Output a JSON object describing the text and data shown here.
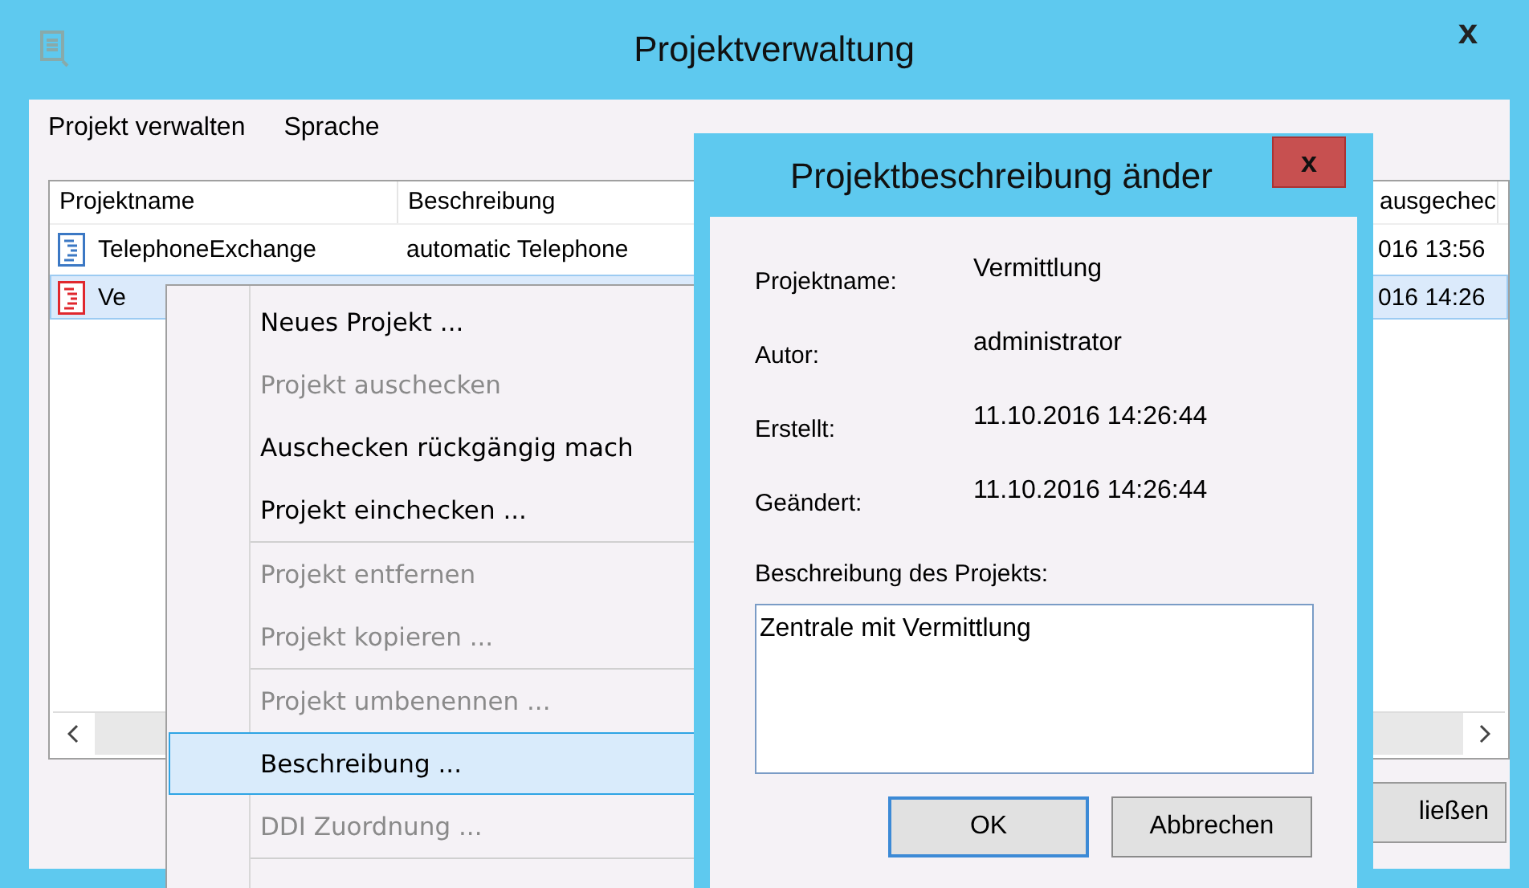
{
  "window": {
    "title": "Projektverwaltung",
    "close": "x"
  },
  "menu_bar": [
    "Projekt verwalten",
    "Sprache"
  ],
  "table": {
    "columns": [
      "Projektname",
      "Beschreibung",
      "ausgechec"
    ],
    "rows": [
      {
        "name": "TelephoneExchange",
        "description": "automatic Telephone",
        "column_3": "016 13:56",
        "color": "#3b78c4",
        "selected": false
      },
      {
        "name": "Ve",
        "column_3": "016 14:26",
        "color": "#e0282e",
        "selected": true
      }
    ]
  },
  "buttons": [
    "ließen"
  ],
  "context_menu": [
    {
      "kind": "item",
      "label": "Neues Projekt ...",
      "disabled": false,
      "selected": false
    },
    {
      "kind": "item",
      "label": "Projekt auschecken",
      "disabled": true,
      "selected": false
    },
    {
      "kind": "item",
      "label": "Auschecken rückgängig mach",
      "disabled": false,
      "selected": false
    },
    {
      "kind": "item",
      "label": "Projekt einchecken ...",
      "disabled": false,
      "selected": false
    },
    {
      "kind": "separator"
    },
    {
      "kind": "item",
      "label": "Projekt entfernen",
      "disabled": true,
      "selected": false
    },
    {
      "kind": "item",
      "label": "Projekt kopieren ...",
      "disabled": true,
      "selected": false
    },
    {
      "kind": "separator"
    },
    {
      "kind": "item",
      "label": "Projekt umbenennen ...",
      "disabled": true,
      "selected": false
    },
    {
      "kind": "item",
      "label": "Beschreibung ...",
      "disabled": false,
      "selected": true
    },
    {
      "kind": "item",
      "label": "DDI Zuordnung ...",
      "disabled": true,
      "selected": false
    },
    {
      "kind": "separator"
    }
  ],
  "dialog": {
    "title": "Projektbeschreibung änder",
    "close": "x",
    "fields": [
      {
        "label": "Projektname:",
        "value": "Vermittlung"
      },
      {
        "label": "Autor:",
        "value": "administrator"
      },
      {
        "label": "Erstellt:",
        "value": "11.10.2016 14:26:44"
      },
      {
        "label": "Geändert:",
        "value": "11.10.2016 14:26:44"
      }
    ],
    "description_label": "Beschreibung des Projekts:",
    "description_value": "Zentrale mit Vermittlung",
    "buttons": [
      {
        "label": "OK",
        "default": true
      },
      {
        "label": "Abbrechen",
        "default": false
      }
    ]
  }
}
